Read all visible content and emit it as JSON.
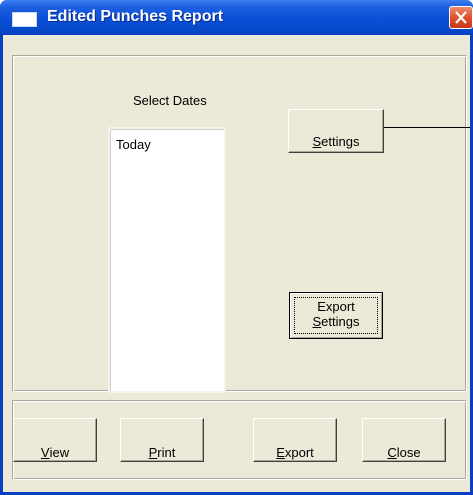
{
  "window": {
    "title": "Edited Punches Report"
  },
  "dates": {
    "label": "Select Dates",
    "items": [
      "Today"
    ]
  },
  "buttons": {
    "settings": "Settings",
    "export_settings_line1": "Export",
    "export_settings_line2": "Settings",
    "view": "View",
    "print": "Print",
    "export": "Export",
    "close": "Close"
  },
  "colors": {
    "titlebar": "#0a4fd8",
    "close_button": "#e0502a",
    "face": "#ece9d8"
  }
}
